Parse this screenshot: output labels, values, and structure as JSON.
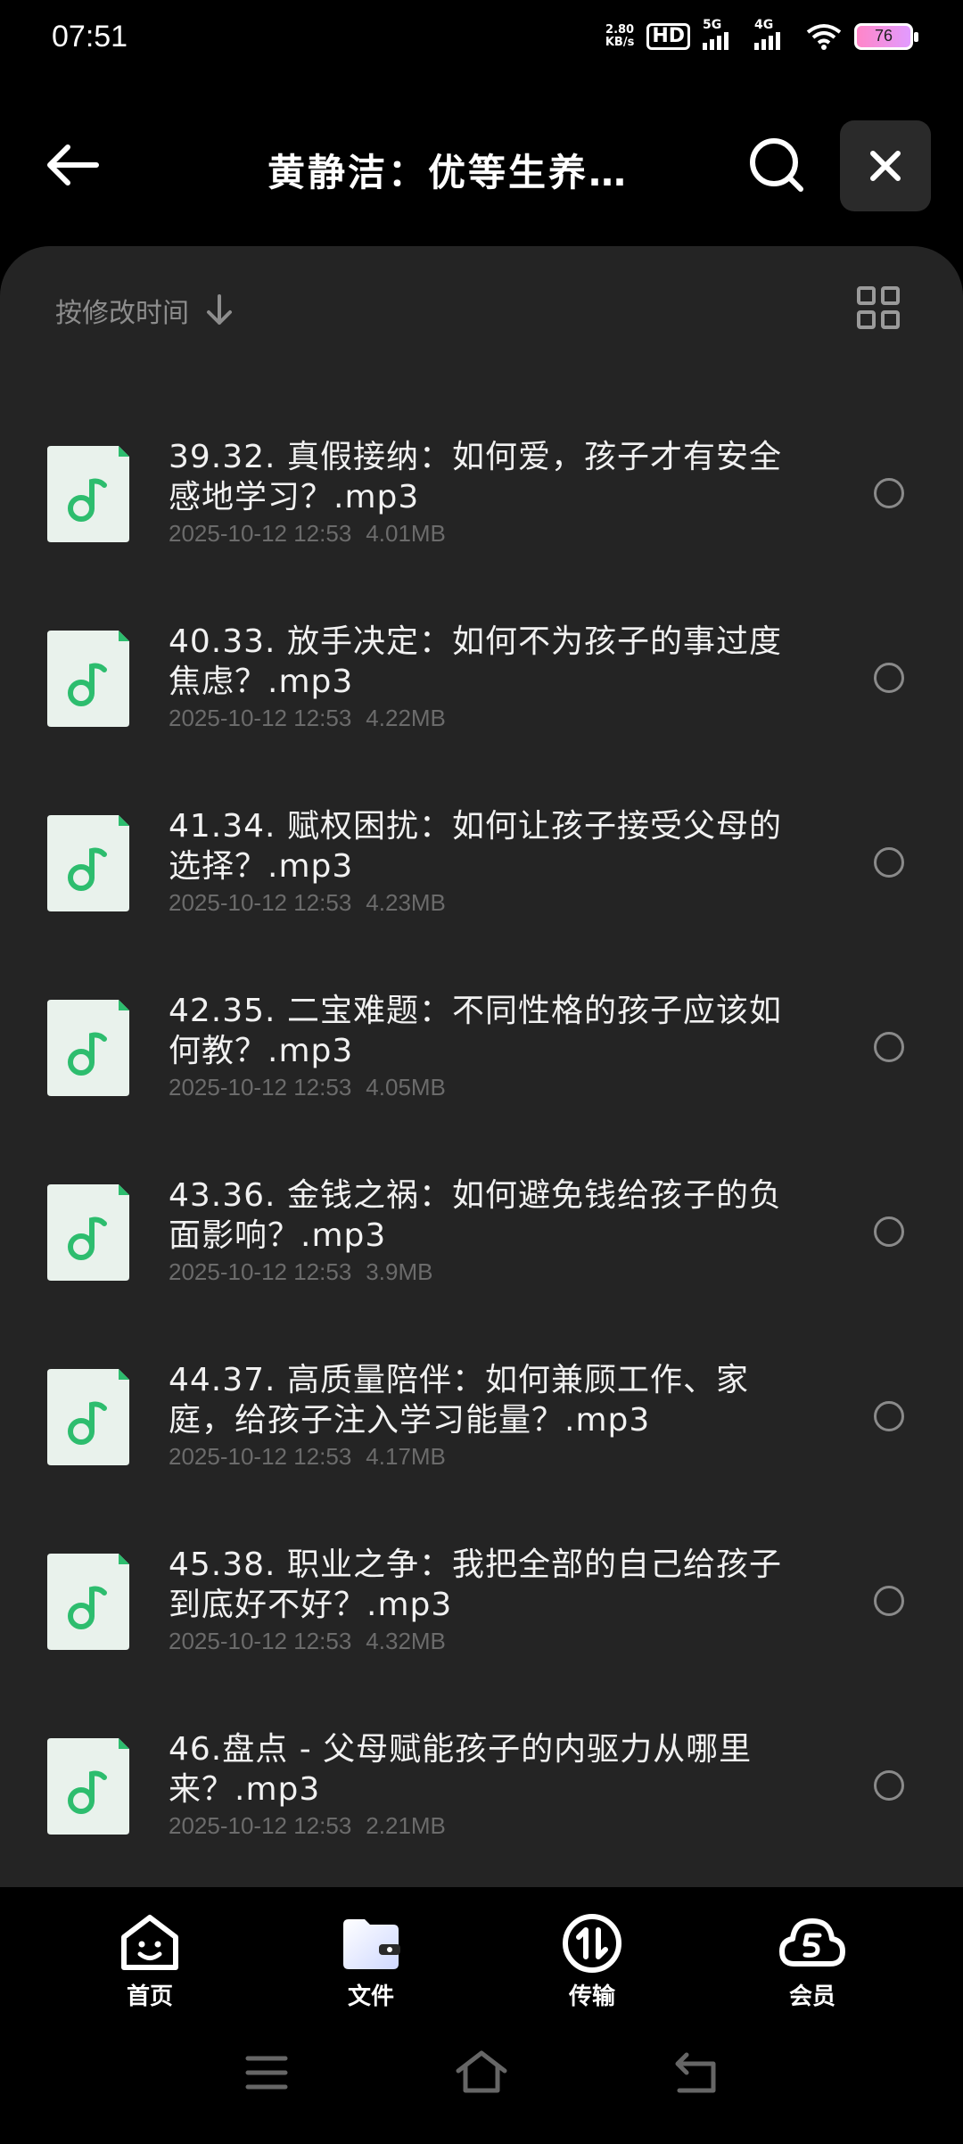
{
  "status": {
    "time": "07:51",
    "netspeed_value": "2.80",
    "netspeed_unit": "KB/s",
    "hd": "HD",
    "sim1": "5G",
    "sim2": "4G",
    "battery": "76",
    "icons": [
      "hd-icon",
      "5g-signal-icon",
      "4g-signal-icon",
      "wifi-icon",
      "battery-icon"
    ]
  },
  "header": {
    "title": "黄静洁：优等生养…",
    "icons": [
      "back-arrow-icon",
      "search-icon",
      "close-icon"
    ]
  },
  "sort": {
    "label": "按修改时间",
    "icons": [
      "arrow-down-icon",
      "grid-view-icon"
    ]
  },
  "files": [
    {
      "name": "39.32. 真假接纳：如何爱，孩子才有安全感地学习？.mp3",
      "date": "2025-10-12 12:53",
      "size": "4.01MB"
    },
    {
      "name": "40.33. 放手决定：如何不为孩子的事过度焦虑？.mp3",
      "date": "2025-10-12 12:53",
      "size": "4.22MB"
    },
    {
      "name": "41.34. 赋权困扰：如何让孩子接受父母的选择？.mp3",
      "date": "2025-10-12 12:53",
      "size": "4.23MB"
    },
    {
      "name": "42.35. 二宝难题：不同性格的孩子应该如何教？.mp3",
      "date": "2025-10-12 12:53",
      "size": "4.05MB"
    },
    {
      "name": "43.36. 金钱之祸：如何避免钱给孩子的负面影响？.mp3",
      "date": "2025-10-12 12:53",
      "size": "3.9MB"
    },
    {
      "name": "44.37. 高质量陪伴：如何兼顾工作、家庭，给孩子注入学习能量？.mp3",
      "date": "2025-10-12 12:53",
      "size": "4.17MB"
    },
    {
      "name": "45.38. 职业之争：我把全部的自己给孩子到底好不好？.mp3",
      "date": "2025-10-12 12:53",
      "size": "4.32MB"
    },
    {
      "name": "46.盘点 - 父母赋能孩子的内驱力从哪里来？.mp3",
      "date": "2025-10-12 12:53",
      "size": "2.21MB"
    }
  ],
  "bottom_nav": [
    {
      "label": "首页",
      "icon": "home-face-icon"
    },
    {
      "label": "文件",
      "icon": "folder-icon"
    },
    {
      "label": "传输",
      "icon": "transfer-icon"
    },
    {
      "label": "会员",
      "icon": "vip-cloud-icon"
    }
  ],
  "colors": {
    "accent": "#2dbd6e",
    "panel": "#242424",
    "background": "#000000"
  }
}
